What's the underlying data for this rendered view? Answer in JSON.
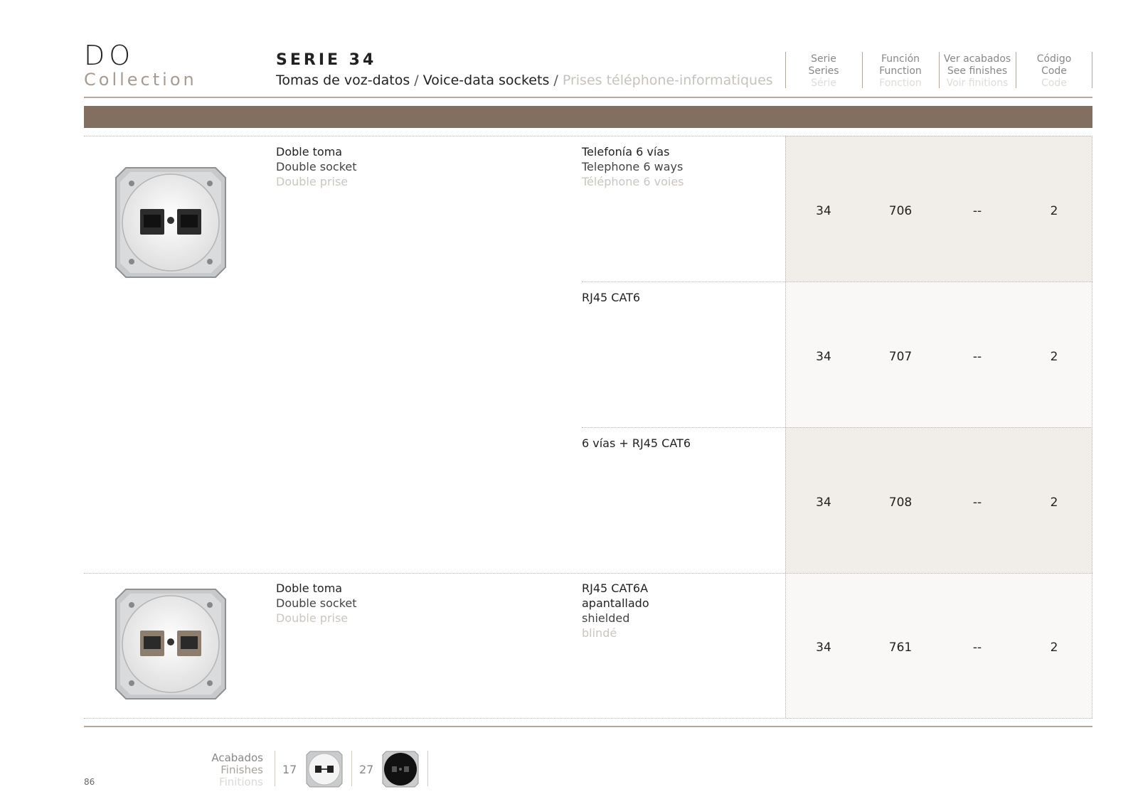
{
  "brand": {
    "name": "DO",
    "subtitle": "Collection"
  },
  "serie": {
    "title": "SERIE 34",
    "subtitle_es": "Tomas de voz-datos",
    "separator": " / ",
    "subtitle_en": "Voice-data sockets",
    "subtitle_fr": "Prises téléphone-informatiques"
  },
  "columns": [
    {
      "es": "Serie",
      "en": "Series",
      "fr": "Série"
    },
    {
      "es": "Función",
      "en": "Function",
      "fr": "Fonction"
    },
    {
      "es": "Ver acabados",
      "en": "See finishes",
      "fr": "Voir finitions"
    },
    {
      "es": "Código",
      "en": "Code",
      "fr": "Code"
    }
  ],
  "products": [
    {
      "name_es": "Doble toma",
      "name_en": "Double socket",
      "name_fr": "Double prise",
      "image": "double-socket-black-rj-icon",
      "rows": [
        {
          "f1": "Telefonía 6 vías",
          "f2": "Telephone 6 ways",
          "f3": "Téléphone 6 voies",
          "f4": "",
          "serie": "34",
          "funcion": "706",
          "acabados": "--",
          "codigo": "2"
        },
        {
          "f1": "RJ45 CAT6",
          "f2": "",
          "f3": "",
          "f4": "",
          "serie": "34",
          "funcion": "707",
          "acabados": "--",
          "codigo": "2"
        },
        {
          "f1": "6 vías + RJ45 CAT6",
          "f2": "",
          "f3": "",
          "f4": "",
          "serie": "34",
          "funcion": "708",
          "acabados": "--",
          "codigo": "2"
        }
      ]
    },
    {
      "name_es": "Doble toma",
      "name_en": "Double socket",
      "name_fr": "Double prise",
      "image": "double-socket-shielded-rj-icon",
      "rows": [
        {
          "f1": "RJ45 CAT6A",
          "f2": "apantallado",
          "f3": "shielded",
          "f4": "blindé",
          "serie": "34",
          "funcion": "761",
          "acabados": "--",
          "codigo": "2"
        }
      ]
    }
  ],
  "finishes": {
    "label_es": "Acabados",
    "label_en": "Finishes",
    "label_fr": "Finitions",
    "items": [
      {
        "number": "17",
        "icon": "white-finish-socket-icon"
      },
      {
        "number": "27",
        "icon": "black-finish-socket-icon"
      }
    ]
  },
  "page_number": "86",
  "colors": {
    "accent_band": "#826f60",
    "rule": "#b3a79d",
    "cell_dark": "#f1ede8",
    "cell_light": "#f9f8f6"
  }
}
